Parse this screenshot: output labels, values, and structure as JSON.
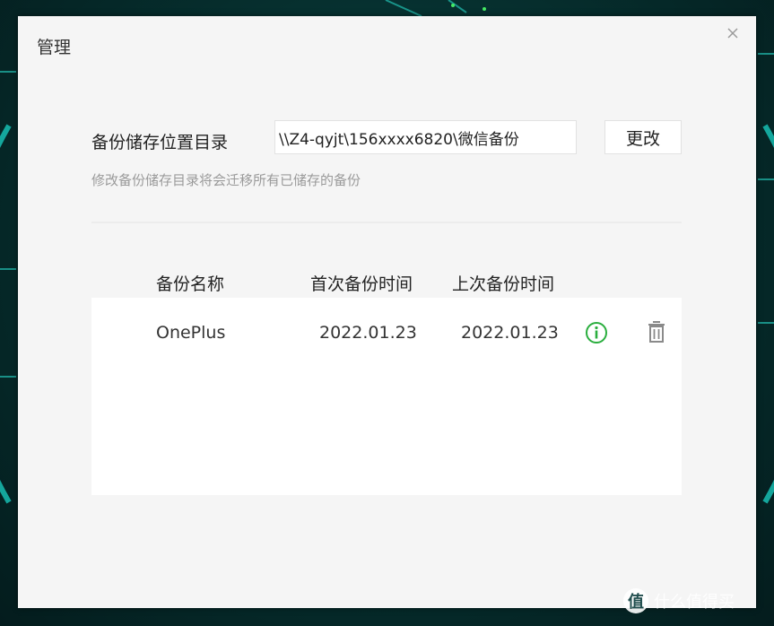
{
  "dialog": {
    "title": "管理",
    "close_icon": "close-icon"
  },
  "storage": {
    "label": "备份储存位置目录",
    "path_value": "\\\\Z4-qyjt\\156xxxx6820\\微信备份",
    "change_button": "更改",
    "hint": "修改备份储存目录将会迁移所有已储存的备份"
  },
  "table": {
    "columns": [
      "备份名称",
      "首次备份时间",
      "上次备份时间"
    ],
    "rows": [
      {
        "name": "OnePlus",
        "first_backup": "2022.01.23",
        "last_backup": "2022.01.23",
        "actions": [
          "info-icon",
          "trash-icon"
        ]
      }
    ]
  },
  "watermark": {
    "logo": "值",
    "text": "什么值得买"
  },
  "colors": {
    "dialog_bg": "#f5f5f5",
    "info_green": "#2aae3e",
    "icon_gray": "#8a8a8a"
  }
}
